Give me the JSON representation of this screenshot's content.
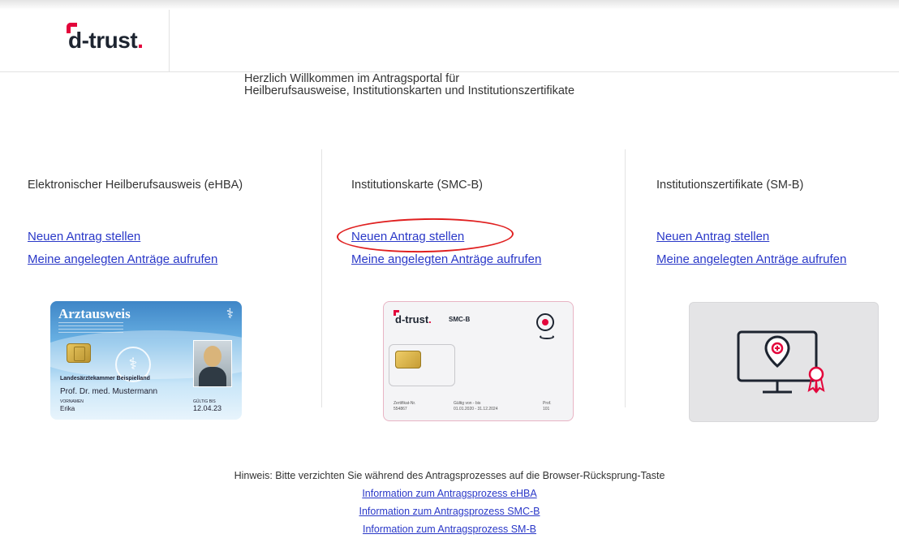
{
  "header": {
    "logo_text": "d-trust",
    "logo_dot": "."
  },
  "welcome": {
    "line1": "Herzlich Willkommen im Antragsportal für",
    "line2": "Heilberufsausweise, Institutionskarten und Institutionszertifikate"
  },
  "columns": [
    {
      "title": "Elektronischer Heilberufsausweis (eHBA)",
      "new_link": "Neuen Antrag stellen",
      "mine_link": "Meine angelegten Anträge aufrufen",
      "card": {
        "heading": "Arztausweis",
        "chamber": "Landesärztekammer Beispielland",
        "name": "Prof. Dr. med. Mustermann",
        "firstname_label": "VORNAMEN",
        "firstname": "Erika",
        "valid_label": "GÜLTIG BIS",
        "valid": "12.04.23"
      }
    },
    {
      "title": "Institutionskarte (SMC-B)",
      "new_link": "Neuen Antrag stellen",
      "mine_link": "Meine angelegten Anträge aufrufen",
      "card": {
        "brand": "d-trust",
        "brand_dot": ".",
        "type": "SMC-B",
        "fine1_label": "Zertifikat-Nr.",
        "fine1": "554867",
        "fine2_label": "Gültig von - bis",
        "fine2": "01.01.2020 - 31.12.2024",
        "fine3_label": "Prof.",
        "fine3": "101"
      }
    },
    {
      "title": "Institutionszertifikate (SM-B)",
      "new_link": "Neuen Antrag stellen",
      "mine_link": "Meine angelegten Anträge aufrufen"
    }
  ],
  "footer": {
    "note": "Hinweis: Bitte verzichten Sie während des Antragsprozesses auf die Browser-Rücksprung-Taste",
    "links": [
      "Information zum Antragsprozess eHBA",
      "Information zum Antragsprozess SMC-B",
      "Information zum Antragsprozess SM-B"
    ]
  },
  "colors": {
    "brand_red": "#e3053b",
    "link_blue": "#2a38c8",
    "highlight_red": "#e02020"
  }
}
